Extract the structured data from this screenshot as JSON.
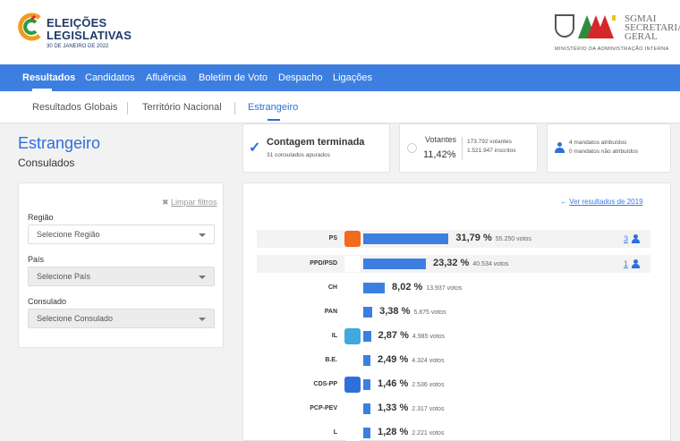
{
  "header": {
    "logo_line1": "ELEIÇÕES",
    "logo_line2": "LEGISLATIVAS",
    "logo_date": "30 DE JANEIRO DE 2022",
    "gov_name1": "SGMAI",
    "gov_name2": "SECRETARIA",
    "gov_name3": "GERAL",
    "gov_ministry": "MINISTÉRIO DA ADMINISTRAÇÃO INTERNA"
  },
  "nav": {
    "items": [
      "Resultados",
      "Candidatos",
      "Afluência",
      "Boletim de Voto",
      "Despacho",
      "Ligações"
    ],
    "active": "Resultados"
  },
  "subnav": {
    "items": [
      "Resultados Globais",
      "Território Nacional",
      "Estrangeiro"
    ],
    "active": "Estrangeiro"
  },
  "page": {
    "title": "Estrangeiro",
    "subtitle": "Consulados"
  },
  "summary": {
    "status_title": "Contagem terminada",
    "status_sub": "31 consulados apurados",
    "votantes_label": "Votantes",
    "votantes_pct": "11,42%",
    "votantes_detail1": "173.792 votantes",
    "votantes_detail2": "1.521.947 inscritos",
    "mandatos1": "4 mandatos atribuídos",
    "mandatos2": "0 mandatos não atribuídos"
  },
  "filters": {
    "clear_label": "Limpar filtros",
    "regiao_label": "Região",
    "regiao_value": "Selecione Região",
    "pais_label": "País",
    "pais_value": "Selecione País",
    "consulado_label": "Consulado",
    "consulado_value": "Selecione Consulado"
  },
  "results": {
    "link_label": "Ver resultados de 2019",
    "bar_color": "#3d7fe0",
    "parties": [
      {
        "name": "PS",
        "pct": "31,79 %",
        "votes": "55.250 votos",
        "share": 31.79,
        "seats": "3"
      },
      {
        "name": "PPD/PSD",
        "pct": "23,32 %",
        "votes": "40.534 votos",
        "share": 23.32,
        "seats": "1"
      },
      {
        "name": "CH",
        "pct": "8,02 %",
        "votes": "13.937 votos",
        "share": 8.02
      },
      {
        "name": "PAN",
        "pct": "3,38 %",
        "votes": "5.875 votos",
        "share": 3.38
      },
      {
        "name": "IL",
        "pct": "2,87 %",
        "votes": "4.985 votos",
        "share": 2.87
      },
      {
        "name": "B.E.",
        "pct": "2,49 %",
        "votes": "4.324 votos",
        "share": 2.49
      },
      {
        "name": "CDS-PP",
        "pct": "1,46 %",
        "votes": "2.536 votos",
        "share": 1.46
      },
      {
        "name": "PCP-PEV",
        "pct": "1,33 %",
        "votes": "2.317 votos",
        "share": 1.33
      },
      {
        "name": "L",
        "pct": "1,28 %",
        "votes": "2.221 votos",
        "share": 1.28
      }
    ]
  }
}
